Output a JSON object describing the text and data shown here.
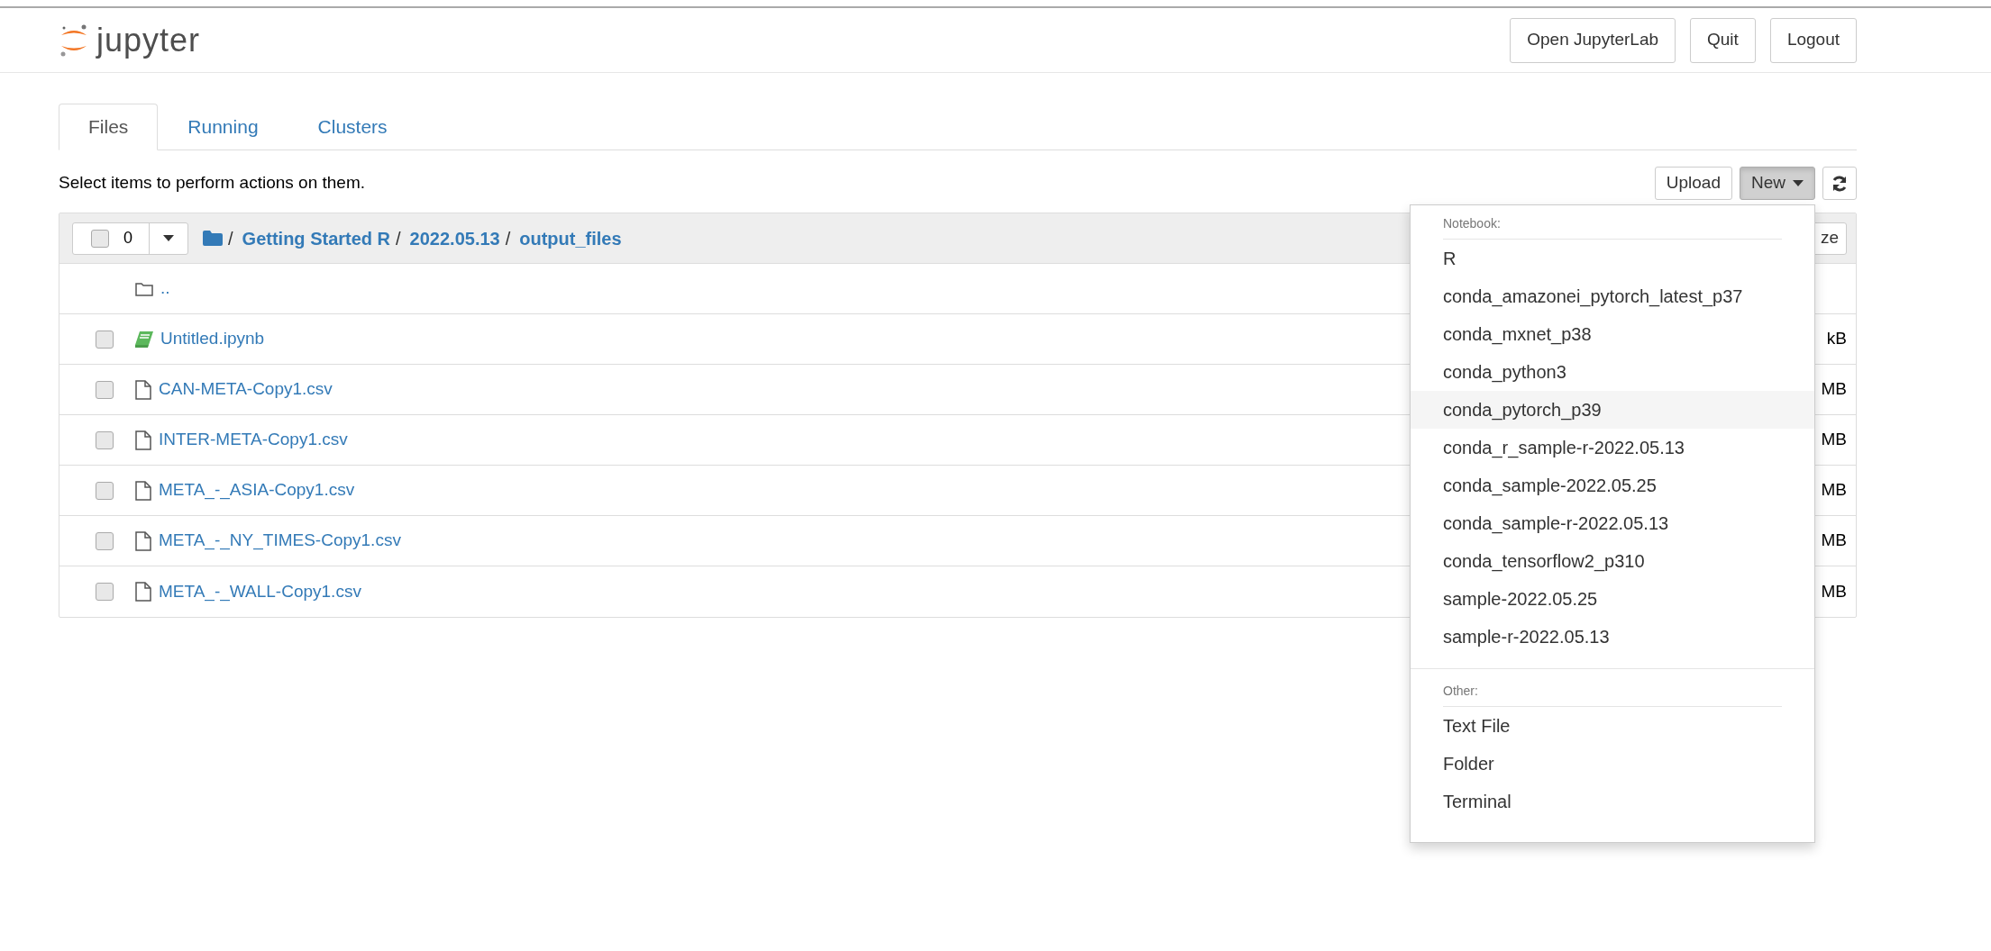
{
  "header": {
    "logo_text": "jupyter",
    "buttons": [
      "Open JupyterLab",
      "Quit",
      "Logout"
    ]
  },
  "tabs": [
    {
      "label": "Files",
      "selected": true
    },
    {
      "label": "Running",
      "selected": false
    },
    {
      "label": "Clusters",
      "selected": false
    }
  ],
  "toolbar": {
    "hint": "Select items to perform actions on them.",
    "upload": "Upload",
    "new_button": {
      "label": "New",
      "expanded": true
    }
  },
  "file_list": {
    "select_all_checked": false,
    "selected_count": "0",
    "breadcrumb": [
      {
        "separator": "/",
        "label": "Getting Started R"
      },
      {
        "separator": "/",
        "label": "2022.05.13"
      },
      {
        "separator": "/",
        "label": "output_files"
      }
    ],
    "header_button": "ze",
    "items": [
      {
        "kind": "parent",
        "name": ".."
      },
      {
        "kind": "notebook",
        "name": "Untitled.ipynb",
        "checked": false,
        "size": "kB"
      },
      {
        "kind": "file",
        "name": "CAN-META-Copy1.csv",
        "checked": false,
        "size": "MB"
      },
      {
        "kind": "file",
        "name": "INTER-META-Copy1.csv",
        "checked": false,
        "size": "MB"
      },
      {
        "kind": "file",
        "name": "META_-_ASIA-Copy1.csv",
        "checked": false,
        "size": "MB"
      },
      {
        "kind": "file",
        "name": "META_-_NY_TIMES-Copy1.csv",
        "checked": false,
        "size": "MB"
      },
      {
        "kind": "file",
        "name": "META_-_WALL-Copy1.csv",
        "checked": false,
        "size": "MB"
      }
    ]
  },
  "new_menu": {
    "sections": [
      {
        "header": "Notebook:",
        "items": [
          {
            "label": "R",
            "selected": false
          },
          {
            "label": "conda_amazonei_pytorch_latest_p37",
            "selected": false
          },
          {
            "label": "conda_mxnet_p38",
            "selected": false
          },
          {
            "label": "conda_python3",
            "selected": false
          },
          {
            "label": "conda_pytorch_p39",
            "selected": true
          },
          {
            "label": "conda_r_sample-r-2022.05.13",
            "selected": false
          },
          {
            "label": "conda_sample-2022.05.25",
            "selected": false
          },
          {
            "label": "conda_sample-r-2022.05.13",
            "selected": false
          },
          {
            "label": "conda_tensorflow2_p310",
            "selected": false
          },
          {
            "label": "sample-2022.05.25",
            "selected": false
          },
          {
            "label": "sample-r-2022.05.13",
            "selected": false
          }
        ]
      },
      {
        "header": "Other:",
        "items": [
          {
            "label": "Text File",
            "selected": false
          },
          {
            "label": "Folder",
            "selected": false
          },
          {
            "label": "Terminal",
            "selected": false
          }
        ]
      }
    ]
  }
}
